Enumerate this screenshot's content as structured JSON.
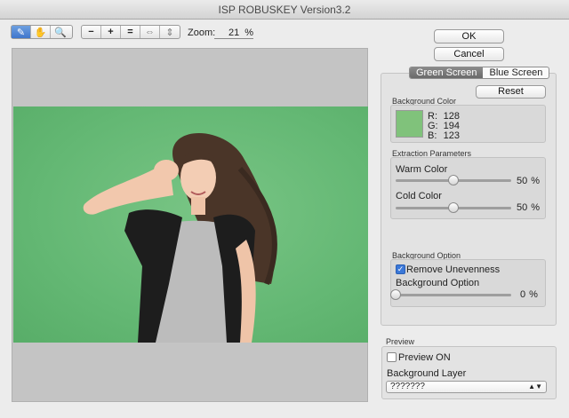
{
  "window": {
    "title": "ISP ROBUSKEY Version3.2"
  },
  "toolbar": {
    "tools": [
      {
        "name": "pen-tool-icon",
        "glyph": "✎"
      },
      {
        "name": "hand-tool-icon",
        "glyph": "✋"
      },
      {
        "name": "zoom-tool-icon",
        "glyph": "🔍"
      }
    ],
    "zoom_buttons": [
      {
        "name": "zoom-out-icon",
        "glyph": "−"
      },
      {
        "name": "zoom-in-icon",
        "glyph": "+"
      },
      {
        "name": "actual-size-icon",
        "glyph": "="
      },
      {
        "name": "fit-width-icon",
        "glyph": "⇔"
      },
      {
        "name": "fit-height-icon",
        "glyph": "⇕"
      }
    ],
    "zoom_label": "Zoom:",
    "zoom_value": "21",
    "zoom_unit": "%"
  },
  "buttons": {
    "ok": "OK",
    "cancel": "Cancel",
    "reset": "Reset"
  },
  "tabs": {
    "green": "Green Screen",
    "blue": "Blue Screen",
    "selected": "green"
  },
  "background_color": {
    "label": "Background Color",
    "swatch": "#80c27b",
    "r_label": "R:",
    "r": "128",
    "g_label": "G:",
    "g": "194",
    "b_label": "B:",
    "b": "123"
  },
  "extraction": {
    "label": "Extraction Parameters",
    "warm_label": "Warm Color",
    "warm_value": "50",
    "warm_level": 0.5,
    "cold_label": "Cold Color",
    "cold_value": "50",
    "cold_level": 0.5,
    "unit": "%"
  },
  "background_option": {
    "section_label": "Background Option",
    "remove_unevenness_label": "Remove Unevenness",
    "remove_unevenness_checked": true,
    "slider_label": "Background Option",
    "slider_value": "0",
    "slider_level": 0,
    "unit": "%"
  },
  "preview": {
    "section_label": "Preview",
    "preview_on_label": "Preview ON",
    "preview_on_checked": false,
    "layer_label": "Background Layer",
    "layer_value": "???????"
  }
}
